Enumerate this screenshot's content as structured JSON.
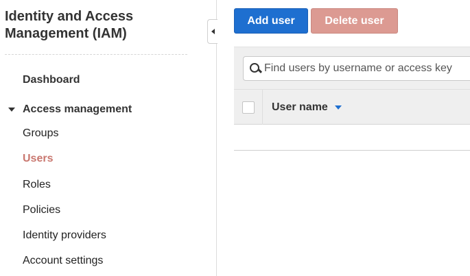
{
  "sidebar": {
    "title": "Identity and Access Management (IAM)",
    "dashboard_label": "Dashboard",
    "section_label": "Access management",
    "items": [
      {
        "label": "Groups",
        "active": false
      },
      {
        "label": "Users",
        "active": true
      },
      {
        "label": "Roles",
        "active": false
      },
      {
        "label": "Policies",
        "active": false
      },
      {
        "label": "Identity providers",
        "active": false
      },
      {
        "label": "Account settings",
        "active": false
      }
    ]
  },
  "toolbar": {
    "add_label": "Add user",
    "delete_label": "Delete user"
  },
  "search": {
    "placeholder": "Find users by username or access key",
    "value": ""
  },
  "table": {
    "columns": [
      {
        "label": "User name",
        "sort": "descending"
      }
    ]
  },
  "colors": {
    "primary_button": "#1e6fd0",
    "disabled_delete_button": "#dc9a92",
    "active_nav": "#c9776f"
  },
  "icons": {
    "search": "search-icon",
    "section_caret": "caret-down-icon",
    "collapse": "caret-left-icon",
    "sort": "sort-desc-icon"
  }
}
